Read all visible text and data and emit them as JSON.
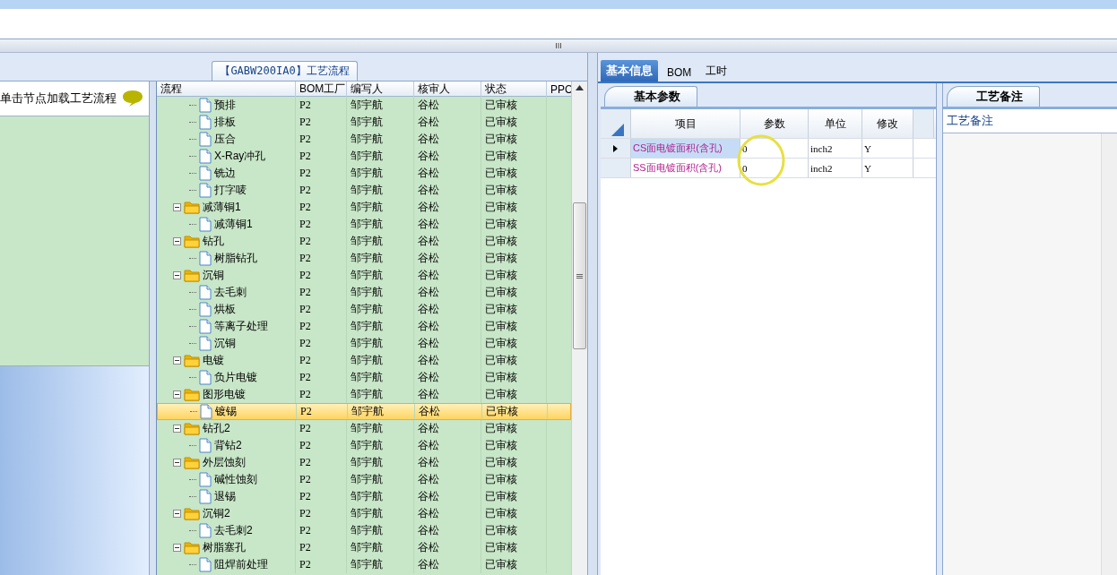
{
  "left_panel": {
    "hint": "单击节点加载工艺流程"
  },
  "flow_panel": {
    "title": "【GABW200IA0】工艺流程",
    "columns": [
      "流程",
      "BOM工厂",
      "编写人",
      "核审人",
      "状态",
      "PPC"
    ],
    "tree": {
      "continued": [
        {
          "label": "预排",
          "bom": "P2",
          "author": "邹宇航",
          "reviewer": "谷松",
          "status": "已审核",
          "selected": false
        },
        {
          "label": "排板",
          "bom": "P2",
          "author": "邹宇航",
          "reviewer": "谷松",
          "status": "已审核",
          "selected": false
        },
        {
          "label": "压合",
          "bom": "P2",
          "author": "邹宇航",
          "reviewer": "谷松",
          "status": "已审核",
          "selected": false
        },
        {
          "label": "X-Ray冲孔",
          "bom": "P2",
          "author": "邹宇航",
          "reviewer": "谷松",
          "status": "已审核",
          "selected": false
        },
        {
          "label": "铣边",
          "bom": "P2",
          "author": "邹宇航",
          "reviewer": "谷松",
          "status": "已审核",
          "selected": false
        },
        {
          "label": "打字唛",
          "bom": "P2",
          "author": "邹宇航",
          "reviewer": "谷松",
          "status": "已审核",
          "selected": false
        }
      ],
      "nodes": [
        {
          "label": "减薄铜1",
          "bom": "P2",
          "author": "邹宇航",
          "reviewer": "谷松",
          "status": "已审核",
          "selected": false,
          "expanded": true,
          "children": [
            {
              "label": "减薄铜1",
              "bom": "P2",
              "author": "邹宇航",
              "reviewer": "谷松",
              "status": "已审核",
              "selected": false
            }
          ]
        },
        {
          "label": "钻孔",
          "bom": "P2",
          "author": "邹宇航",
          "reviewer": "谷松",
          "status": "已审核",
          "selected": false,
          "expanded": true,
          "children": [
            {
              "label": "树脂钻孔",
              "bom": "P2",
              "author": "邹宇航",
              "reviewer": "谷松",
              "status": "已审核",
              "selected": false
            }
          ]
        },
        {
          "label": "沉铜",
          "bom": "P2",
          "author": "邹宇航",
          "reviewer": "谷松",
          "status": "已审核",
          "selected": false,
          "expanded": true,
          "children": [
            {
              "label": "去毛刺",
              "bom": "P2",
              "author": "邹宇航",
              "reviewer": "谷松",
              "status": "已审核",
              "selected": false
            },
            {
              "label": "烘板",
              "bom": "P2",
              "author": "邹宇航",
              "reviewer": "谷松",
              "status": "已审核",
              "selected": false
            },
            {
              "label": "等离子处理",
              "bom": "P2",
              "author": "邹宇航",
              "reviewer": "谷松",
              "status": "已审核",
              "selected": false
            },
            {
              "label": "沉铜",
              "bom": "P2",
              "author": "邹宇航",
              "reviewer": "谷松",
              "status": "已审核",
              "selected": false
            }
          ]
        },
        {
          "label": "电镀",
          "bom": "P2",
          "author": "邹宇航",
          "reviewer": "谷松",
          "status": "已审核",
          "selected": false,
          "expanded": true,
          "children": [
            {
              "label": "负片电镀",
              "bom": "P2",
              "author": "邹宇航",
              "reviewer": "谷松",
              "status": "已审核",
              "selected": false
            }
          ]
        },
        {
          "label": "图形电镀",
          "bom": "P2",
          "author": "邹宇航",
          "reviewer": "谷松",
          "status": "已审核",
          "selected": false,
          "expanded": true,
          "children": [
            {
              "label": "镀锡",
              "bom": "P2",
              "author": "邹宇航",
              "reviewer": "谷松",
              "status": "已审核",
              "selected": true
            }
          ]
        },
        {
          "label": "钻孔2",
          "bom": "P2",
          "author": "邹宇航",
          "reviewer": "谷松",
          "status": "已审核",
          "selected": false,
          "expanded": true,
          "children": [
            {
              "label": "背钻2",
              "bom": "P2",
              "author": "邹宇航",
              "reviewer": "谷松",
              "status": "已审核",
              "selected": false
            }
          ]
        },
        {
          "label": "外层蚀刻",
          "bom": "P2",
          "author": "邹宇航",
          "reviewer": "谷松",
          "status": "已审核",
          "selected": false,
          "expanded": true,
          "children": [
            {
              "label": "碱性蚀刻",
              "bom": "P2",
              "author": "邹宇航",
              "reviewer": "谷松",
              "status": "已审核",
              "selected": false
            },
            {
              "label": "退锡",
              "bom": "P2",
              "author": "邹宇航",
              "reviewer": "谷松",
              "status": "已审核",
              "selected": false
            }
          ]
        },
        {
          "label": "沉铜2",
          "bom": "P2",
          "author": "邹宇航",
          "reviewer": "谷松",
          "status": "已审核",
          "selected": false,
          "expanded": true,
          "children": [
            {
              "label": "去毛刺2",
              "bom": "P2",
              "author": "邹宇航",
              "reviewer": "谷松",
              "status": "已审核",
              "selected": false
            }
          ]
        },
        {
          "label": "树脂塞孔",
          "bom": "P2",
          "author": "邹宇航",
          "reviewer": "谷松",
          "status": "已审核",
          "selected": false,
          "expanded": true,
          "children": [
            {
              "label": "阻焊前处理",
              "bom": "P2",
              "author": "邹宇航",
              "reviewer": "谷松",
              "status": "已审核",
              "selected": false
            }
          ]
        }
      ]
    }
  },
  "tabs": [
    {
      "label": "基本信息",
      "selected": true
    },
    {
      "label": "BOM",
      "selected": false
    },
    {
      "label": "工时",
      "selected": false
    }
  ],
  "params_panel": {
    "tab": "基本参数",
    "columns": [
      "项目",
      "参数",
      "单位",
      "修改"
    ],
    "rows": [
      {
        "item": "CS面电镀面积(含孔)",
        "value": "0",
        "unit": "inch2",
        "modify": "Y",
        "current": true
      },
      {
        "item": "SS面电镀面积(含孔)",
        "value": "0",
        "unit": "inch2",
        "modify": "Y",
        "current": false
      }
    ]
  },
  "notes_panel": {
    "tab": "工艺备注",
    "label": "工艺备注"
  }
}
